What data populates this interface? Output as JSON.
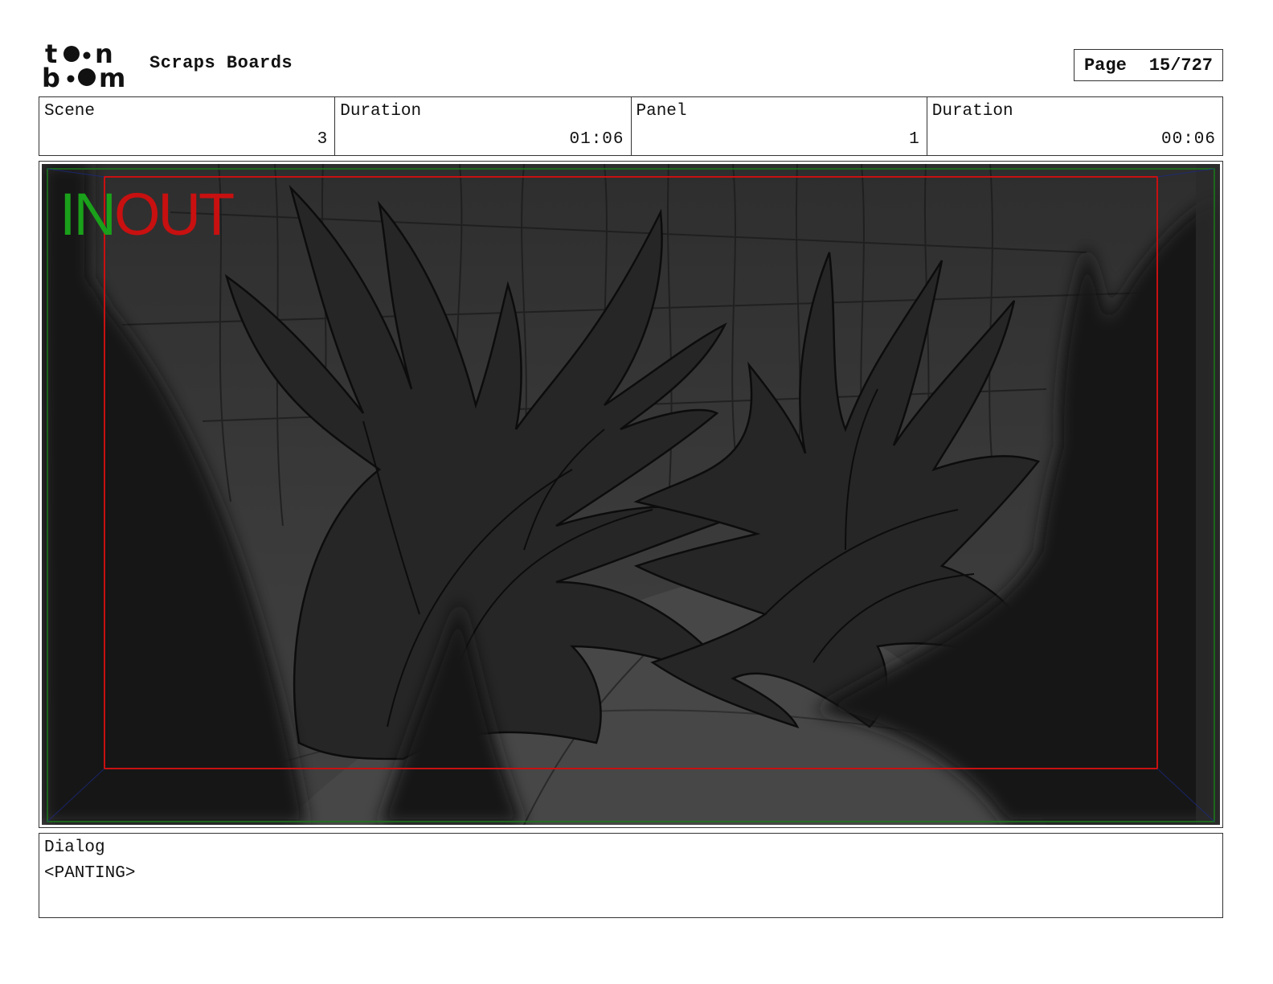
{
  "header": {
    "project_title": "Scraps Boards",
    "page_label": "Page",
    "page_value": "15/727"
  },
  "info": {
    "scene_label": "Scene",
    "scene_value": "3",
    "scene_duration_label": "Duration",
    "scene_duration_value": "01:06",
    "panel_label": "Panel",
    "panel_value": "1",
    "panel_duration_label": "Duration",
    "panel_duration_value": "00:06"
  },
  "panel": {
    "in_marker": "IN",
    "out_marker": "OUT",
    "in_color": "#1aa01a",
    "out_color": "#c81010",
    "frame_safe_color": "#c81010",
    "frame_outer_color": "#1a7a1a"
  },
  "dialog": {
    "label": "Dialog",
    "text": "<PANTING>"
  }
}
